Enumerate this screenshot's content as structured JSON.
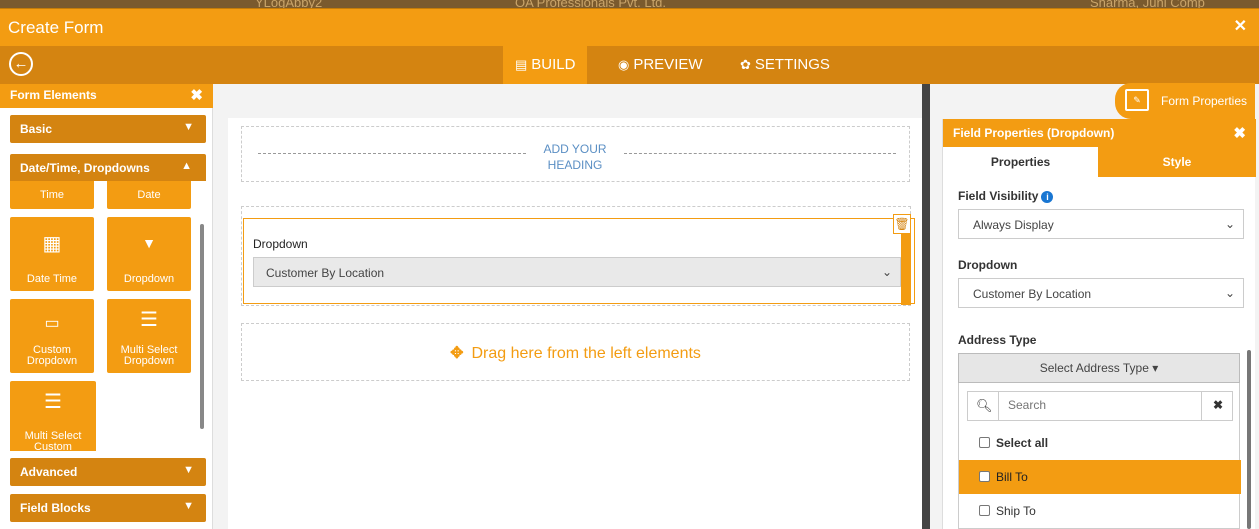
{
  "background_app": {
    "fragments": [
      "YLogAbby2",
      "OA Professionals Pvt. Ltd.",
      "Sharma, Juhi Comp"
    ]
  },
  "window": {
    "title": "Create Form",
    "close_icon": "close-icon"
  },
  "toolbar": {
    "back_icon": "back-arrow-icon",
    "tabs": [
      {
        "label": "BUILD",
        "icon": "form-icon",
        "active": true
      },
      {
        "label": "PREVIEW",
        "icon": "eye-icon",
        "active": false
      },
      {
        "label": "SETTINGS",
        "icon": "gear-icon",
        "active": false
      }
    ]
  },
  "left_panel": {
    "title": "Form Elements",
    "sections": {
      "basic": "Basic",
      "datetime": "Date/Time, Dropdowns",
      "advanced": "Advanced",
      "field_blocks": "Field Blocks"
    },
    "elements": [
      {
        "label": "Time",
        "icon": "clock-icon"
      },
      {
        "label": "Date",
        "icon": "calendar-icon"
      },
      {
        "label": "Date Time",
        "icon": "calendar-clock-icon"
      },
      {
        "label": "Dropdown",
        "icon": "caret-down-icon"
      },
      {
        "label": "Custom Dropdown",
        "icon": "custom-dropdown-icon"
      },
      {
        "label": "Multi Select Dropdown",
        "icon": "multi-select-icon"
      },
      {
        "label": "Multi Select Custom",
        "icon": "multi-select-icon"
      }
    ]
  },
  "canvas": {
    "heading_placeholder": "ADD YOUR HEADING",
    "dropdown_field": {
      "label": "Dropdown",
      "value": "Customer By Location"
    },
    "drop_hint": "Drag here from the left elements"
  },
  "form_properties_button": "Form Properties",
  "right_panel": {
    "title": "Field Properties (Dropdown)",
    "tabs": {
      "properties": "Properties",
      "style": "Style"
    },
    "field_visibility": {
      "label": "Field Visibility",
      "value": "Always Display"
    },
    "dropdown": {
      "label": "Dropdown",
      "value": "Customer By Location"
    },
    "address_type": {
      "label": "Address Type",
      "button": "Select Address Type",
      "search_placeholder": "Search",
      "options": [
        {
          "label": "Select all",
          "bold": true,
          "highlighted": false
        },
        {
          "label": "Bill To",
          "bold": false,
          "highlighted": true
        },
        {
          "label": "Ship To",
          "bold": false,
          "highlighted": false
        }
      ]
    }
  },
  "colors": {
    "accent": "#f39c12",
    "accent_dark": "#d48411",
    "link_blue": "#5b8fc4"
  }
}
